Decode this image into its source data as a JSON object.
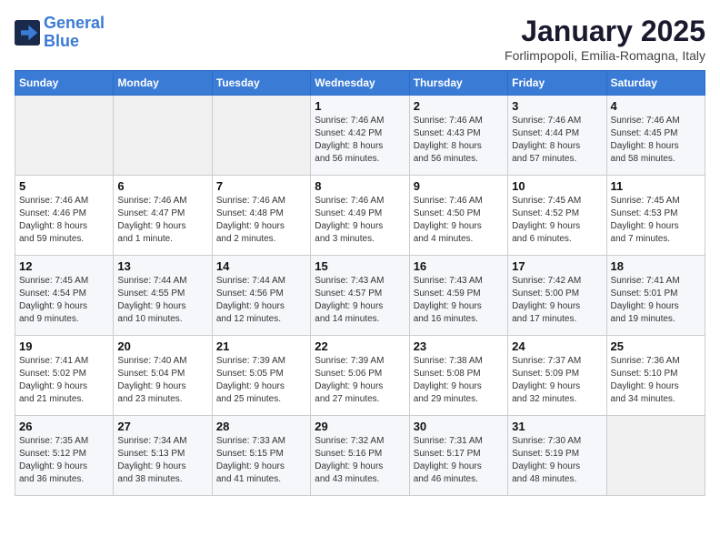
{
  "header": {
    "logo_line1": "General",
    "logo_line2": "Blue",
    "month": "January 2025",
    "location": "Forlimpopoli, Emilia-Romagna, Italy"
  },
  "days_of_week": [
    "Sunday",
    "Monday",
    "Tuesday",
    "Wednesday",
    "Thursday",
    "Friday",
    "Saturday"
  ],
  "weeks": [
    [
      {
        "num": "",
        "detail": ""
      },
      {
        "num": "",
        "detail": ""
      },
      {
        "num": "",
        "detail": ""
      },
      {
        "num": "1",
        "detail": "Sunrise: 7:46 AM\nSunset: 4:42 PM\nDaylight: 8 hours\nand 56 minutes."
      },
      {
        "num": "2",
        "detail": "Sunrise: 7:46 AM\nSunset: 4:43 PM\nDaylight: 8 hours\nand 56 minutes."
      },
      {
        "num": "3",
        "detail": "Sunrise: 7:46 AM\nSunset: 4:44 PM\nDaylight: 8 hours\nand 57 minutes."
      },
      {
        "num": "4",
        "detail": "Sunrise: 7:46 AM\nSunset: 4:45 PM\nDaylight: 8 hours\nand 58 minutes."
      }
    ],
    [
      {
        "num": "5",
        "detail": "Sunrise: 7:46 AM\nSunset: 4:46 PM\nDaylight: 8 hours\nand 59 minutes."
      },
      {
        "num": "6",
        "detail": "Sunrise: 7:46 AM\nSunset: 4:47 PM\nDaylight: 9 hours\nand 1 minute."
      },
      {
        "num": "7",
        "detail": "Sunrise: 7:46 AM\nSunset: 4:48 PM\nDaylight: 9 hours\nand 2 minutes."
      },
      {
        "num": "8",
        "detail": "Sunrise: 7:46 AM\nSunset: 4:49 PM\nDaylight: 9 hours\nand 3 minutes."
      },
      {
        "num": "9",
        "detail": "Sunrise: 7:46 AM\nSunset: 4:50 PM\nDaylight: 9 hours\nand 4 minutes."
      },
      {
        "num": "10",
        "detail": "Sunrise: 7:45 AM\nSunset: 4:52 PM\nDaylight: 9 hours\nand 6 minutes."
      },
      {
        "num": "11",
        "detail": "Sunrise: 7:45 AM\nSunset: 4:53 PM\nDaylight: 9 hours\nand 7 minutes."
      }
    ],
    [
      {
        "num": "12",
        "detail": "Sunrise: 7:45 AM\nSunset: 4:54 PM\nDaylight: 9 hours\nand 9 minutes."
      },
      {
        "num": "13",
        "detail": "Sunrise: 7:44 AM\nSunset: 4:55 PM\nDaylight: 9 hours\nand 10 minutes."
      },
      {
        "num": "14",
        "detail": "Sunrise: 7:44 AM\nSunset: 4:56 PM\nDaylight: 9 hours\nand 12 minutes."
      },
      {
        "num": "15",
        "detail": "Sunrise: 7:43 AM\nSunset: 4:57 PM\nDaylight: 9 hours\nand 14 minutes."
      },
      {
        "num": "16",
        "detail": "Sunrise: 7:43 AM\nSunset: 4:59 PM\nDaylight: 9 hours\nand 16 minutes."
      },
      {
        "num": "17",
        "detail": "Sunrise: 7:42 AM\nSunset: 5:00 PM\nDaylight: 9 hours\nand 17 minutes."
      },
      {
        "num": "18",
        "detail": "Sunrise: 7:41 AM\nSunset: 5:01 PM\nDaylight: 9 hours\nand 19 minutes."
      }
    ],
    [
      {
        "num": "19",
        "detail": "Sunrise: 7:41 AM\nSunset: 5:02 PM\nDaylight: 9 hours\nand 21 minutes."
      },
      {
        "num": "20",
        "detail": "Sunrise: 7:40 AM\nSunset: 5:04 PM\nDaylight: 9 hours\nand 23 minutes."
      },
      {
        "num": "21",
        "detail": "Sunrise: 7:39 AM\nSunset: 5:05 PM\nDaylight: 9 hours\nand 25 minutes."
      },
      {
        "num": "22",
        "detail": "Sunrise: 7:39 AM\nSunset: 5:06 PM\nDaylight: 9 hours\nand 27 minutes."
      },
      {
        "num": "23",
        "detail": "Sunrise: 7:38 AM\nSunset: 5:08 PM\nDaylight: 9 hours\nand 29 minutes."
      },
      {
        "num": "24",
        "detail": "Sunrise: 7:37 AM\nSunset: 5:09 PM\nDaylight: 9 hours\nand 32 minutes."
      },
      {
        "num": "25",
        "detail": "Sunrise: 7:36 AM\nSunset: 5:10 PM\nDaylight: 9 hours\nand 34 minutes."
      }
    ],
    [
      {
        "num": "26",
        "detail": "Sunrise: 7:35 AM\nSunset: 5:12 PM\nDaylight: 9 hours\nand 36 minutes."
      },
      {
        "num": "27",
        "detail": "Sunrise: 7:34 AM\nSunset: 5:13 PM\nDaylight: 9 hours\nand 38 minutes."
      },
      {
        "num": "28",
        "detail": "Sunrise: 7:33 AM\nSunset: 5:15 PM\nDaylight: 9 hours\nand 41 minutes."
      },
      {
        "num": "29",
        "detail": "Sunrise: 7:32 AM\nSunset: 5:16 PM\nDaylight: 9 hours\nand 43 minutes."
      },
      {
        "num": "30",
        "detail": "Sunrise: 7:31 AM\nSunset: 5:17 PM\nDaylight: 9 hours\nand 46 minutes."
      },
      {
        "num": "31",
        "detail": "Sunrise: 7:30 AM\nSunset: 5:19 PM\nDaylight: 9 hours\nand 48 minutes."
      },
      {
        "num": "",
        "detail": ""
      }
    ]
  ]
}
